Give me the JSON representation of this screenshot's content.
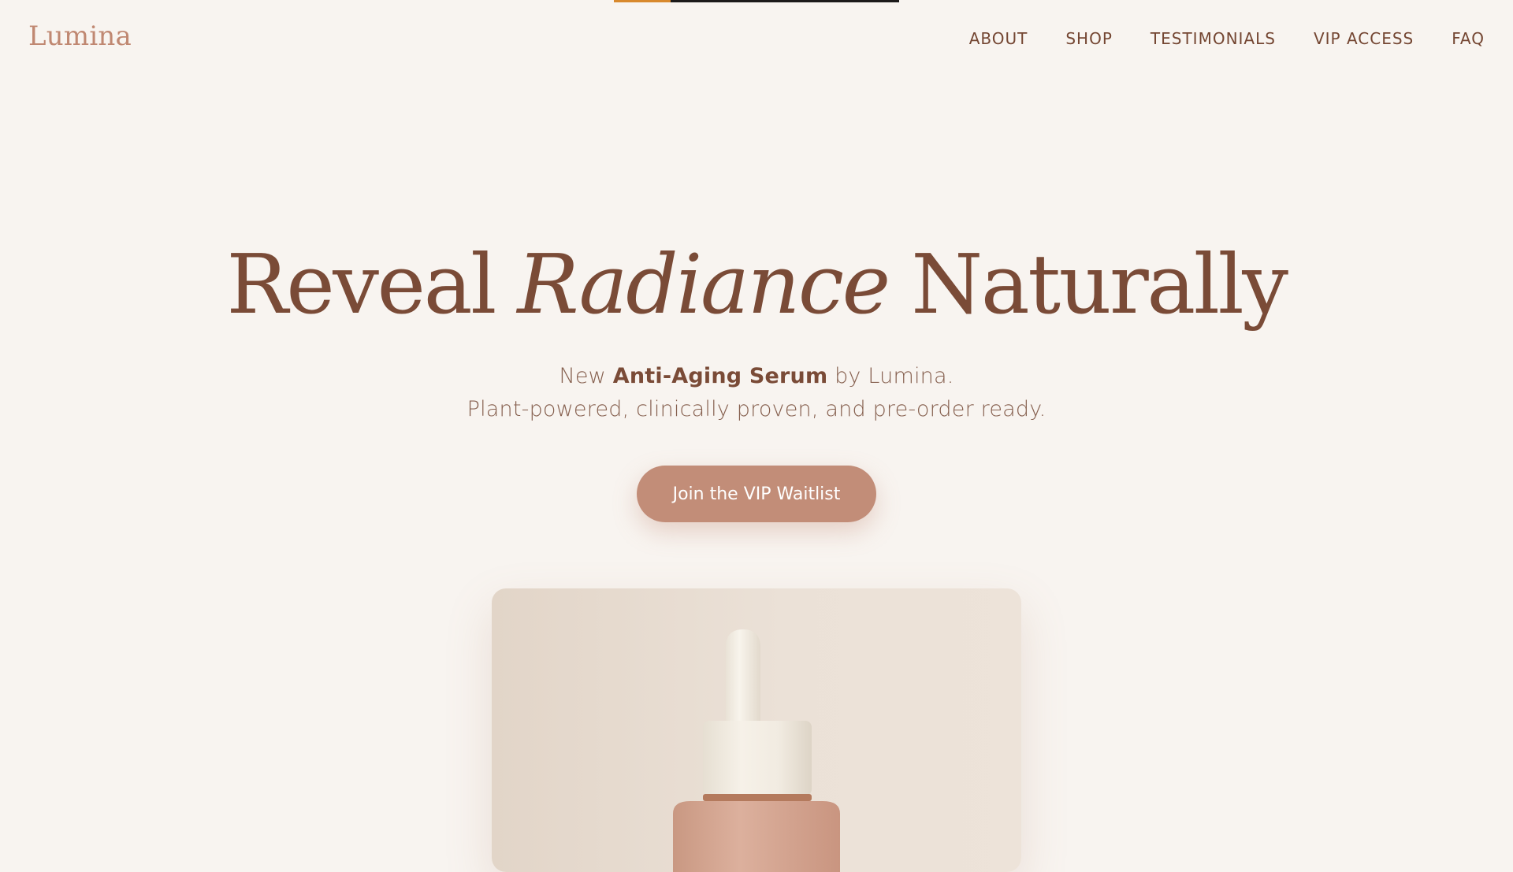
{
  "brand": {
    "name": "Lumina",
    "color": "#c08872"
  },
  "top_progress": {
    "fill_fraction": 0.2,
    "fill_color": "#d8892d",
    "track_color": "#1c1a1a"
  },
  "nav": {
    "items": [
      {
        "label": "ABOUT"
      },
      {
        "label": "SHOP"
      },
      {
        "label": "TESTIMONIALS"
      },
      {
        "label": "VIP ACCESS"
      },
      {
        "label": "FAQ"
      }
    ]
  },
  "hero": {
    "title_before": "Reveal ",
    "title_accent": "Radiance",
    "title_after": " Naturally",
    "sub_prefix": "New ",
    "sub_product": "Anti-Aging Serum",
    "sub_suffix": " by Lumina.",
    "sub_line2": "Plant-powered, clinically proven, and pre-order ready.",
    "cta_label": "Join the VIP Waitlist"
  },
  "product_image": {
    "icon": "serum-dropper-bottle-icon"
  },
  "colors": {
    "background": "#f8f4f0",
    "text_primary": "#7a4b37",
    "accent": "#c28d78"
  }
}
